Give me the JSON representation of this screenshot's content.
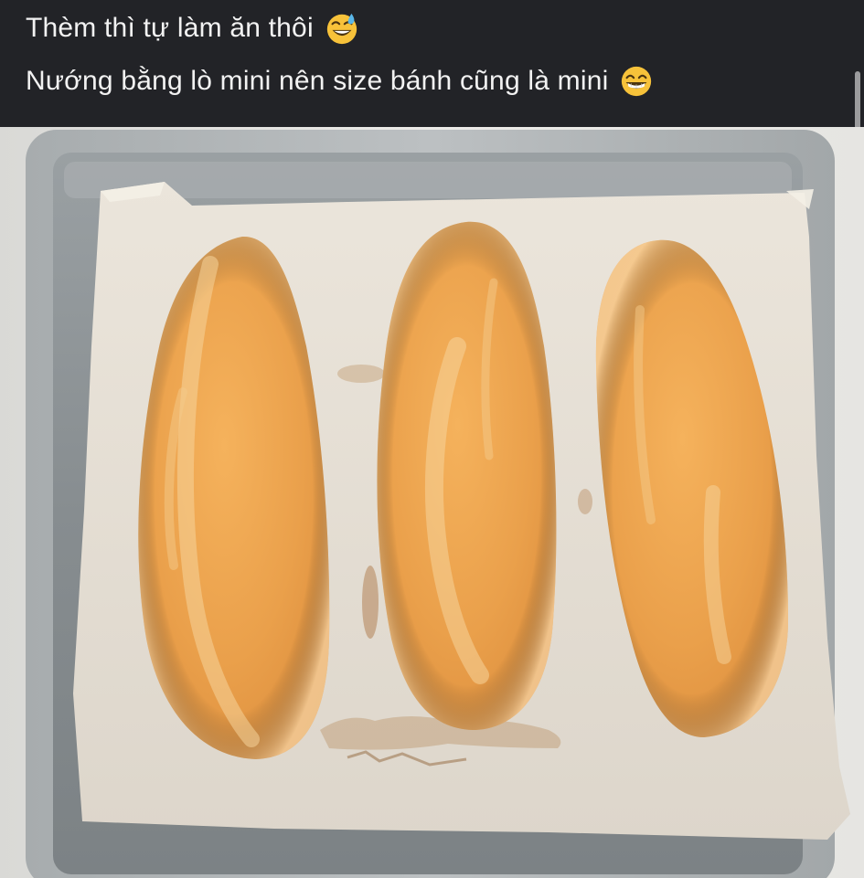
{
  "post": {
    "caption_line1": "Thèm thì tự làm ăn thôi",
    "caption_line1_emoji": "grinning-face-with-sweat-icon",
    "caption_line2": "Nướng bằng lò mini nên size bánh cũng là mini",
    "caption_line2_emoji": "beaming-face-icon"
  },
  "photo": {
    "subject_count": 3
  },
  "colors": {
    "caption_bg": "#222327",
    "caption_text": "#f2f2f2",
    "emoji_yellow": "#f7c23a",
    "tray_metal": "#8e9396",
    "parchment": "#e8e2d8",
    "crust": "#e39a45"
  }
}
